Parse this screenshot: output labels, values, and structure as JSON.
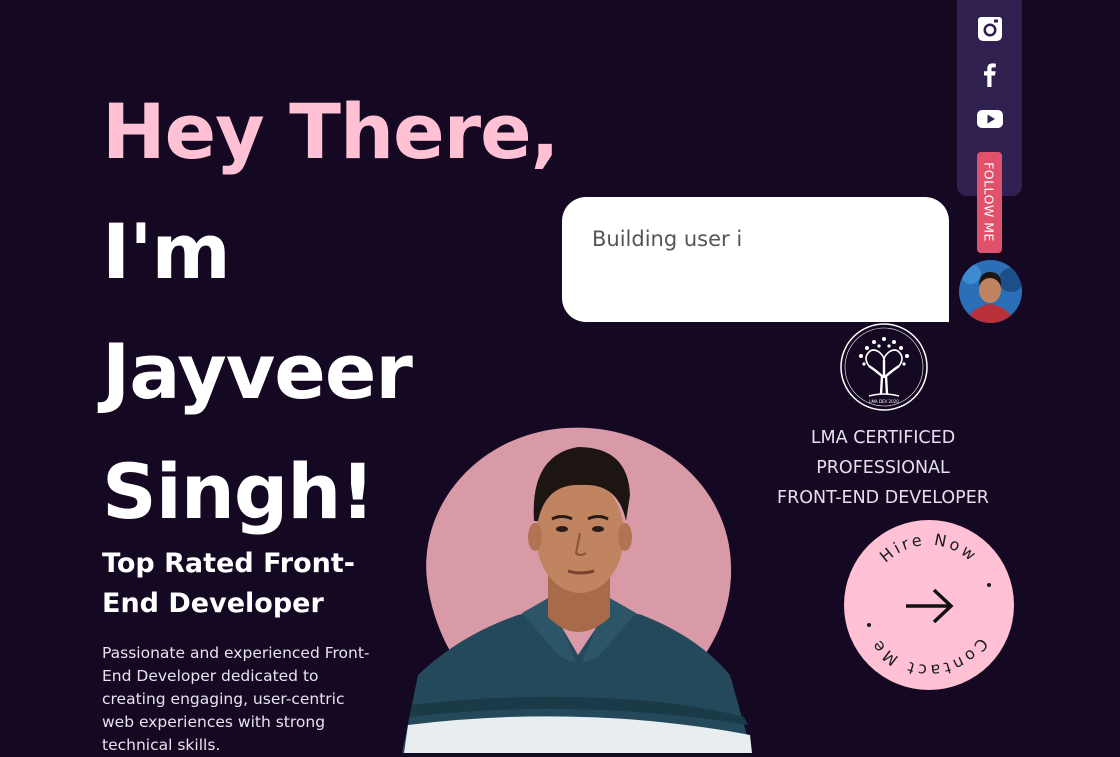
{
  "hero": {
    "line1": "Hey There,",
    "line2": "I'm",
    "line3": "Jayveer",
    "line4": "Singh!",
    "subtitle": "Top Rated Front-End Developer",
    "description": "Passionate and experienced Front-End Developer dedicated to creating engaging, user-centric web experiences with strong technical skills."
  },
  "speech_bubble": {
    "text": "Building user i"
  },
  "social": {
    "icons": [
      "instagram-icon",
      "facebook-icon",
      "youtube-icon"
    ],
    "follow_label": "FOLLOW ME"
  },
  "certification": {
    "logo_text": "LMA DEV 2020",
    "line1": "LMA CERTIFICED",
    "line2": "PROFESSIONAL",
    "line3": "FRONT-END DEVELOPER"
  },
  "hire_badge": {
    "top_text": "Hire Now",
    "bottom_text": "Contact Me",
    "arrow_icon": "arrow-right-icon"
  },
  "colors": {
    "background": "#150823",
    "accent_pink": "#ffc1d3",
    "social_bar": "#2f2050",
    "follow_tab": "#e0526c"
  }
}
